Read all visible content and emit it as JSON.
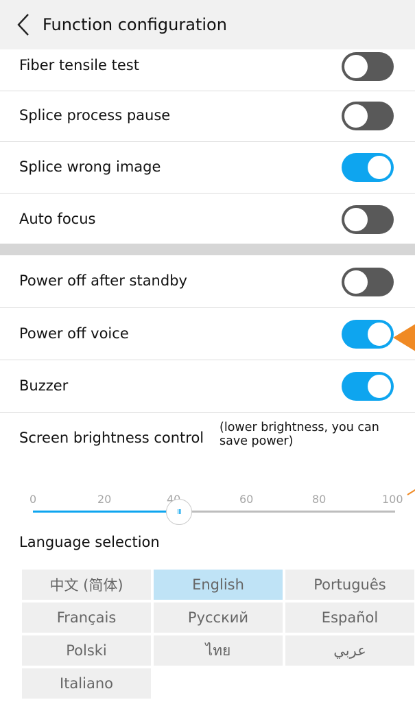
{
  "header": {
    "title": "Function configuration"
  },
  "settings_top": [
    {
      "label": "Fiber tensile test",
      "state": "off"
    },
    {
      "label": "Splice process pause",
      "state": "off"
    },
    {
      "label": "Splice wrong image",
      "state": "on"
    },
    {
      "label": "Auto focus",
      "state": "off"
    }
  ],
  "settings_bottom": [
    {
      "label": "Power off after standby",
      "state": "off"
    },
    {
      "label": "Power off voice",
      "state": "on"
    },
    {
      "label": "Buzzer",
      "state": "on"
    }
  ],
  "brightness": {
    "label": "Screen brightness control",
    "note_line1": "(lower brightness, you can",
    "note_line2": "save power)",
    "ticks": [
      "0",
      "20",
      "40",
      "60",
      "80",
      "100"
    ],
    "value": 40,
    "thumb_glyph": "III"
  },
  "language": {
    "label": "Language selection",
    "options": [
      "中文 (简体)",
      "English",
      "Português",
      "Français",
      "Русский",
      "Español",
      "Polski",
      "ไทย",
      "عربي",
      "Italiano"
    ],
    "selected": "English"
  },
  "colors": {
    "accent": "#0ea5ef",
    "toggle_off": "#595959",
    "annotation": "#f08a24"
  }
}
